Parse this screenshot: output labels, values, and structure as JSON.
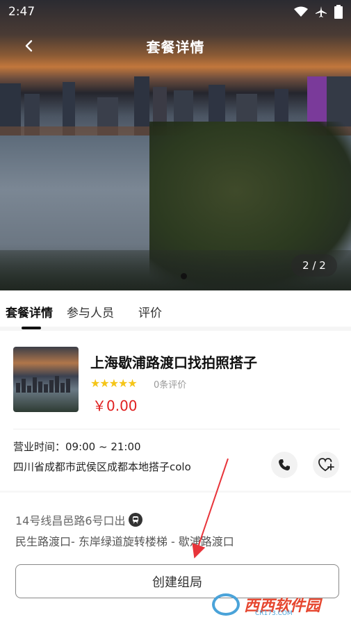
{
  "status_bar": {
    "time": "2:47"
  },
  "nav": {
    "title": "套餐详情"
  },
  "hero": {
    "pager": "2 / 2"
  },
  "tabs": [
    {
      "label": "套餐详情",
      "active": true
    },
    {
      "label": "参与人员",
      "active": false
    },
    {
      "label": "评价",
      "active": false
    }
  ],
  "package": {
    "title": "上海歇浦路渡口找拍照搭子",
    "stars": "★★★★★",
    "rating": 5,
    "reviews": "0条评价",
    "price": "￥0.00"
  },
  "info": {
    "hours": "营业时间：09:00 ~ 21:00",
    "address": "四川省成都市武侯区成都本地搭子colo"
  },
  "route": {
    "line1": "14号线昌邑路6号口出",
    "line2": "民生路渡口- 东岸绿道旋转楼梯 - 歇浦路渡口"
  },
  "actions": {
    "create_label": "创建组局"
  },
  "watermark": {
    "text": "西西软件园",
    "sub": "CR173.COM"
  },
  "colors": {
    "price": "#e02020",
    "stars": "#f5c518",
    "annotation_arrow": "#e8343a"
  },
  "icons": [
    "back-arrow-icon",
    "wifi-icon",
    "airplane-icon",
    "battery-icon",
    "phone-icon",
    "heart-plus-icon",
    "metro-icon"
  ]
}
